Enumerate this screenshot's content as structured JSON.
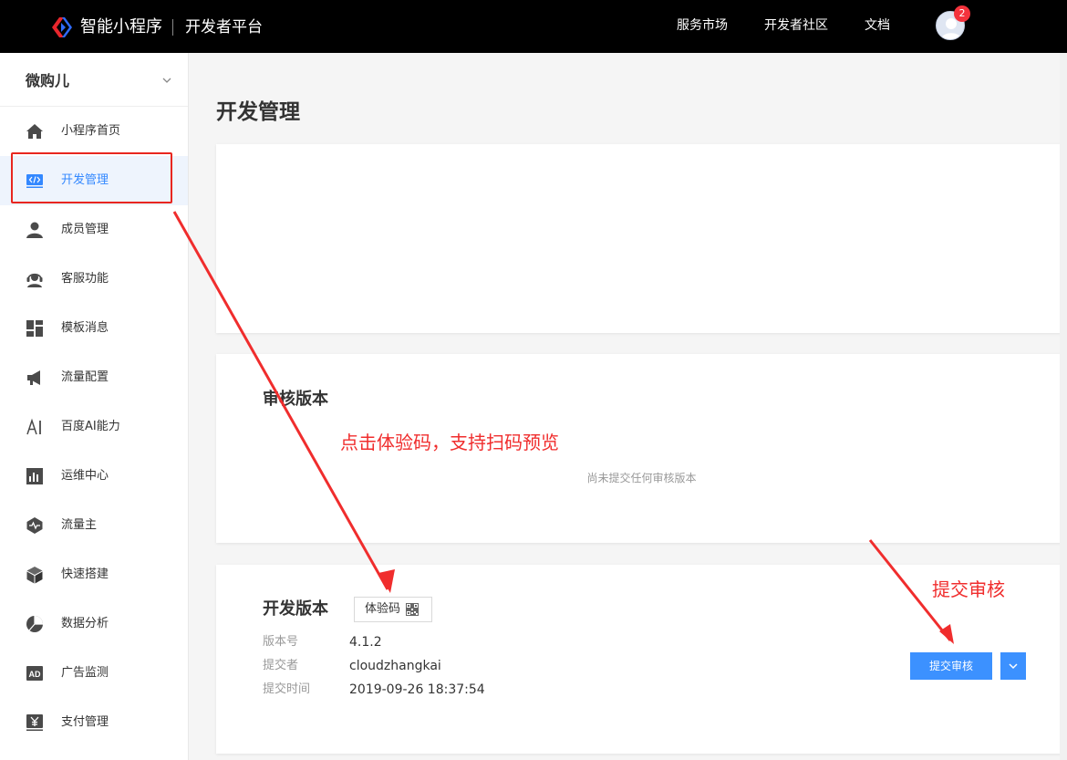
{
  "topbar": {
    "brand": "智能小程序",
    "subtitle": "开发者平台",
    "nav": [
      "服务市场",
      "开发者社区",
      "文档"
    ],
    "notification_count": "2"
  },
  "sidebar": {
    "app_name": "微购儿",
    "items": [
      {
        "label": "小程序首页",
        "icon": "home-icon"
      },
      {
        "label": "开发管理",
        "icon": "code-icon",
        "active": true
      },
      {
        "label": "成员管理",
        "icon": "user-icon"
      },
      {
        "label": "客服功能",
        "icon": "headset-icon"
      },
      {
        "label": "模板消息",
        "icon": "template-icon"
      },
      {
        "label": "流量配置",
        "icon": "megaphone-icon"
      },
      {
        "label": "百度AI能力",
        "icon": "ai-icon"
      },
      {
        "label": "运维中心",
        "icon": "bar-chart-icon"
      },
      {
        "label": "流量主",
        "icon": "pulse-icon"
      },
      {
        "label": "快速搭建",
        "icon": "cube-icon"
      },
      {
        "label": "数据分析",
        "icon": "pie-chart-icon"
      },
      {
        "label": "广告监测",
        "icon": "ad-icon"
      },
      {
        "label": "支付管理",
        "icon": "yen-icon"
      }
    ]
  },
  "main": {
    "title": "开发管理",
    "review": {
      "title": "审核版本",
      "empty": "尚未提交任何审核版本"
    },
    "dev": {
      "title": "开发版本",
      "qr_label": "体验码",
      "fields": [
        {
          "label": "版本号",
          "value": "4.1.2"
        },
        {
          "label": "提交者",
          "value": "cloudzhangkai"
        },
        {
          "label": "提交时间",
          "value": "2019-09-26 18:37:54"
        }
      ],
      "submit_label": "提交审核"
    }
  },
  "annotations": {
    "qr_hint": "点击体验码，支持扫码预览",
    "submit_hint": "提交审核"
  },
  "colors": {
    "accent": "#3c91ff",
    "annotation": "#f02d2d"
  }
}
